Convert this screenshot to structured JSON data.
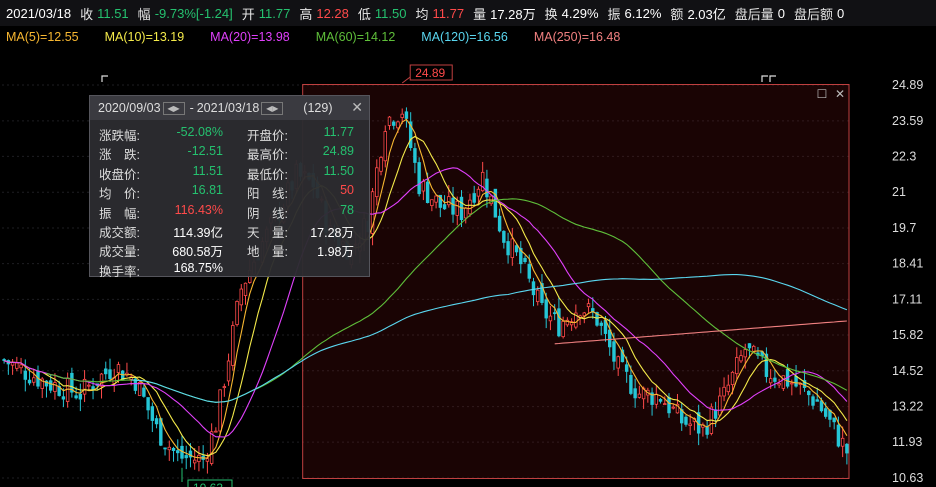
{
  "quote": {
    "date": "2021/03/18",
    "close_label": "收",
    "close": "11.51",
    "change_label": "幅",
    "change": "-9.73%[-1.24]",
    "open_label": "开",
    "open": "11.77",
    "high_label": "高",
    "high": "12.28",
    "low_label": "低",
    "low": "11.50",
    "avg_label": "均",
    "avg": "11.77",
    "volume_label": "量",
    "volume": "17.28万",
    "turnover_label": "换",
    "turnover": "4.29%",
    "amplitude_label": "振",
    "amplitude": "6.12%",
    "amount_label": "额",
    "amount": "2.03亿",
    "after_volume_label": "盘后量",
    "after_volume": "0",
    "after_amount_label": "盘后额",
    "after_amount": "0"
  },
  "ma_legend": [
    {
      "text": "MA(5)=12.55",
      "color": "#f7b731"
    },
    {
      "text": "MA(10)=13.19",
      "color": "#f4ea4a"
    },
    {
      "text": "MA(20)=13.98",
      "color": "#e040fb"
    },
    {
      "text": "MA(60)=14.12",
      "color": "#5fbf3a"
    },
    {
      "text": "MA(120)=16.56",
      "color": "#5ad7f0"
    },
    {
      "text": "MA(250)=16.48",
      "color": "#f08080"
    }
  ],
  "colors": {
    "up": "#ff4a4a",
    "down": "#25c6d6",
    "selection": "#c04040"
  },
  "tooltip": {
    "start": "2020/09/03",
    "sep": "-",
    "end": "2021/03/18",
    "count": "(129)",
    "close_icon": "close-icon",
    "rows": [
      {
        "l1": "涨跌幅:",
        "v1": "-52.08%",
        "c1": "down",
        "l2": "开盘价:",
        "v2": "11.77",
        "c2": "down"
      },
      {
        "l1": "涨　跌:",
        "v1": "-12.51",
        "c1": "down",
        "l2": "最高价:",
        "v2": "24.89",
        "c2": "down"
      },
      {
        "l1": "收盘价:",
        "v1": "11.51",
        "c1": "down",
        "l2": "最低价:",
        "v2": "11.50",
        "c2": "down"
      },
      {
        "l1": "均　价:",
        "v1": "16.81",
        "c1": "down",
        "l2": "阳　线:",
        "v2": "50",
        "c2": "up"
      },
      {
        "l1": "振　幅:",
        "v1": "116.43%",
        "c1": "up",
        "l2": "阴　线:",
        "v2": "78",
        "c2": "down"
      },
      {
        "l1": "成交额:",
        "v1": "114.39亿",
        "c1": "wht",
        "l2": "天　量:",
        "v2": "17.28万",
        "c2": "wht"
      },
      {
        "l1": "成交量:",
        "v1": "680.58万",
        "c1": "wht",
        "l2": "地　量:",
        "v2": "1.98万",
        "c2": "wht"
      },
      {
        "l1": "换手率:",
        "v1": "168.75%",
        "c1": "wht",
        "l2": "",
        "v2": "",
        "c2": "wht"
      }
    ]
  },
  "chart_data": {
    "type": "candlestick",
    "y_ticks": [
      "24.89",
      "23.59",
      "22.3",
      "21",
      "19.7",
      "18.41",
      "17.11",
      "15.82",
      "14.52",
      "13.22",
      "11.93",
      "10.63"
    ],
    "ylim": [
      10.63,
      24.89
    ],
    "high_annotation": "24.89",
    "low_annotation": "10.63",
    "n_candles": 200,
    "selection_start_index": 71,
    "trend_anchors": [
      [
        0,
        14.9
      ],
      [
        10,
        14.1
      ],
      [
        18,
        13.7
      ],
      [
        26,
        14.7
      ],
      [
        31,
        14.2
      ],
      [
        36,
        12.4
      ],
      [
        41,
        11.4
      ],
      [
        47,
        11.3
      ],
      [
        50,
        12.6
      ],
      [
        56,
        17.5
      ],
      [
        60,
        18.9
      ],
      [
        64,
        20.0
      ],
      [
        69,
        21.6
      ],
      [
        73,
        21.3
      ],
      [
        77,
        19.5
      ],
      [
        82,
        18.9
      ],
      [
        86,
        20.0
      ],
      [
        90,
        23.6
      ],
      [
        94,
        24.0
      ],
      [
        98,
        21.3
      ],
      [
        103,
        20.5
      ],
      [
        108,
        20.3
      ],
      [
        113,
        21.6
      ],
      [
        118,
        19.4
      ],
      [
        122,
        18.4
      ],
      [
        127,
        16.7
      ],
      [
        131,
        16.2
      ],
      [
        136,
        16.9
      ],
      [
        140,
        16.4
      ],
      [
        145,
        14.6
      ],
      [
        150,
        13.7
      ],
      [
        155,
        13.6
      ],
      [
        160,
        12.7
      ],
      [
        165,
        12.4
      ],
      [
        170,
        13.6
      ],
      [
        175,
        15.3
      ],
      [
        180,
        14.5
      ],
      [
        186,
        14.1
      ],
      [
        192,
        13.4
      ],
      [
        199,
        11.6
      ]
    ]
  }
}
